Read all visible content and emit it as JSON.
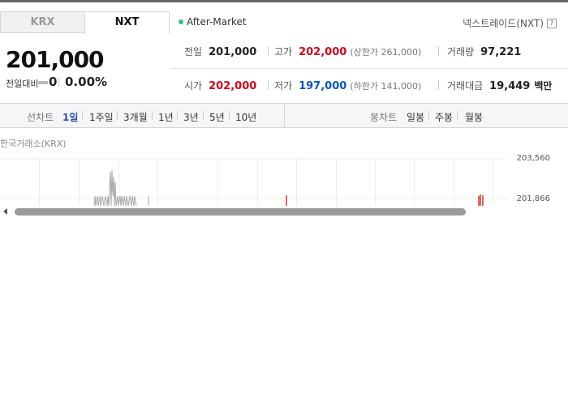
{
  "tabs": {
    "krx": "KRX",
    "nxt": "NXT"
  },
  "session": "After-Market",
  "nxt_link": "넥스트레이드(NXT)",
  "help_icon": "?",
  "price": "201,000",
  "change": {
    "label": "전일대비",
    "value": "0",
    "percent": "0.00%"
  },
  "stats": {
    "prev_close": {
      "label": "전일",
      "value": "201,000"
    },
    "high": {
      "label": "고가",
      "value": "202,000",
      "sub": "(상한가 261,000)"
    },
    "volume": {
      "label": "거래량",
      "value": "97,221"
    },
    "open": {
      "label": "시가",
      "value": "202,000"
    },
    "low": {
      "label": "저가",
      "value": "197,000",
      "sub": "(하한가 141,000)"
    },
    "amount": {
      "label": "거래대금",
      "value": "19,449",
      "unit": "백만"
    }
  },
  "line_chart": {
    "label": "선차트",
    "periods": [
      "1일",
      "1주일",
      "3개월",
      "1년",
      "3년",
      "5년",
      "10년"
    ],
    "selected": "1일"
  },
  "candle_chart": {
    "label": "봉차트",
    "periods": [
      "일봉",
      "주봉",
      "월봉"
    ]
  },
  "exchange_label": "한국거래소(KRX)",
  "chart_data": {
    "type": "line",
    "y_ticks": [
      "203,560",
      "201,866"
    ],
    "ylim": [
      200172,
      203560
    ]
  },
  "colors": {
    "up": "#d6001c",
    "down": "#0055cc",
    "selected": "#2f4fb5",
    "after_market_dot": "#2ebd85"
  }
}
